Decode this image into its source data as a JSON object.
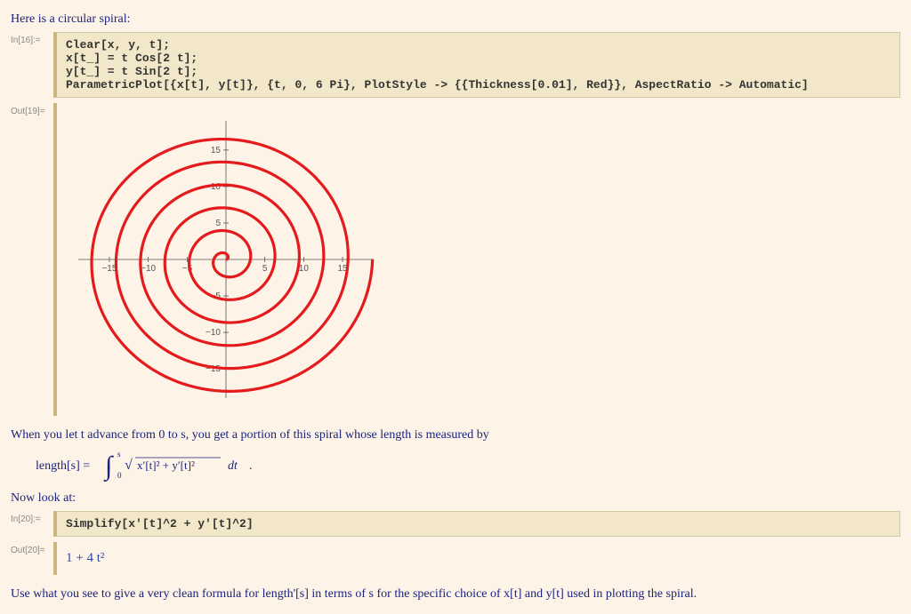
{
  "title_line": "Here is a circular spiral:",
  "input1": {
    "label": "In[16]:=",
    "code": "Clear[x, y, t];\nx[t_] = t Cos[2 t];\ny[t_] = t Sin[2 t];\nParametricPlot[{x[t], y[t]}, {t, 0, 6 Pi}, PlotStyle -> {{Thickness[0.01], Red}}, AspectRatio -> Automatic]"
  },
  "output1_label": "Out[19]=",
  "chart_data": {
    "type": "parametric",
    "x_formula": "t*cos(2t)",
    "y_formula": "t*sin(2t)",
    "t_range": [
      0,
      18.84955592153876
    ],
    "xlim": [
      -19,
      19
    ],
    "ylim": [
      -19,
      19
    ],
    "x_ticks": [
      -15,
      -10,
      -5,
      5,
      10,
      15
    ],
    "y_ticks": [
      -15,
      -10,
      -5,
      5,
      10,
      15
    ],
    "color": "#e41a1c",
    "thickness": 3.2
  },
  "mid_text": "When you let t advance from 0 to s, you get a portion of this spiral whose length is measured by",
  "formula": "length[s] = ∫₀ˢ √( x′[t]² + y′[t]² )  𝑑t   .",
  "now_look": "Now look at:",
  "input2": {
    "label": "In[20]:=",
    "code": "Simplify[x'[t]^2 + y'[t]^2]"
  },
  "output2": {
    "label": "Out[20]=",
    "value": "1 + 4 t²"
  },
  "final_text": "Use what you see to give a very clean formula for length'[s] in terms of s for the specific choice of x[t] and y[t] used in plotting the spiral."
}
